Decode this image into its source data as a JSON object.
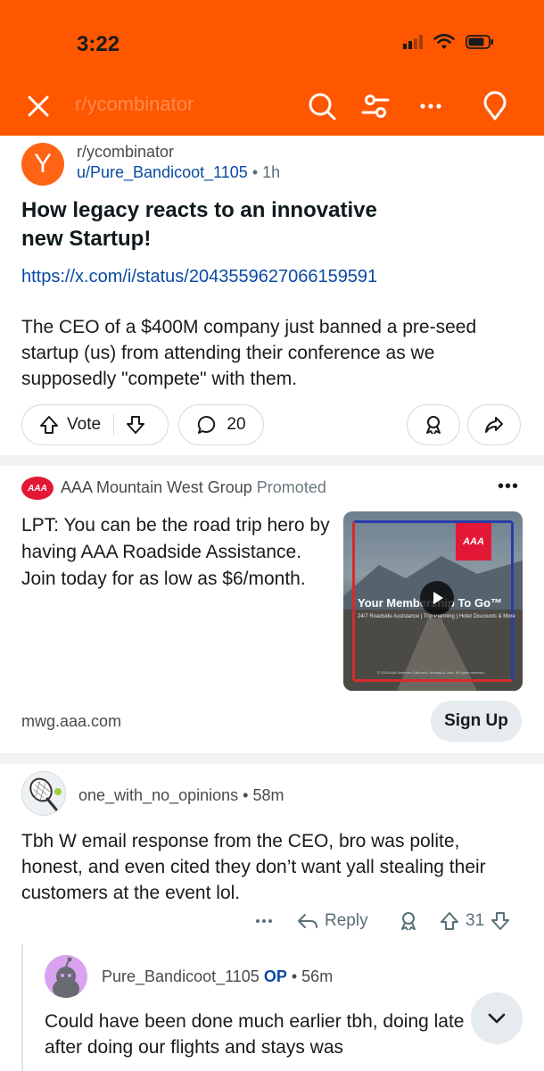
{
  "status_bar": {
    "time": "3:22"
  },
  "toolbar": {
    "title": "r/ycombinator"
  },
  "post": {
    "avatar_letter": "Y",
    "subreddit": "r/ycombinator",
    "author": "u/Pure_Bandicoot_1105",
    "age": "1h",
    "title": "How legacy reacts to an innovative new Startup!",
    "link": "https://x.com/i/status/2043559627066159591",
    "body": "The CEO of a $400M company just banned a pre-seed startup (us) from attending their conference as we supposedly \"compete\" with them.",
    "vote_label": "Vote",
    "comment_count": "20"
  },
  "ad": {
    "logo_text": "AAA",
    "advertiser": "AAA Mountain West Group",
    "promoted_label": "Promoted",
    "text": "LPT: You can be the road trip hero by having AAA Roadside Assistance. Join today for as low as $6/month.",
    "media_headline": "Your Membership To Go™",
    "media_sub": "24/7 Roadside Assistance | Trip Planning | Hotel Discounts & More",
    "media_legal": "© 2025 AAA Northern California, Nevada & Utah. All rights reserved.",
    "domain": "mwg.aaa.com",
    "cta": "Sign Up"
  },
  "comment": {
    "author": "one_with_no_opinions",
    "age": "58m",
    "text": "Tbh W email response from the CEO, bro was polite, honest, and even cited they don’t want yall stealing their customers at the event lol.",
    "reply_label": "Reply",
    "score": "31"
  },
  "reply": {
    "author": "Pure_Bandicoot_1105",
    "op_badge": "OP",
    "age": "56m",
    "text": "Could have been done much earlier tbh, doing late after doing our flights and stays was"
  },
  "colors": {
    "brand_orange": "#ff5700",
    "link_blue": "#0b4aa2",
    "aaa_red": "#e31837"
  }
}
